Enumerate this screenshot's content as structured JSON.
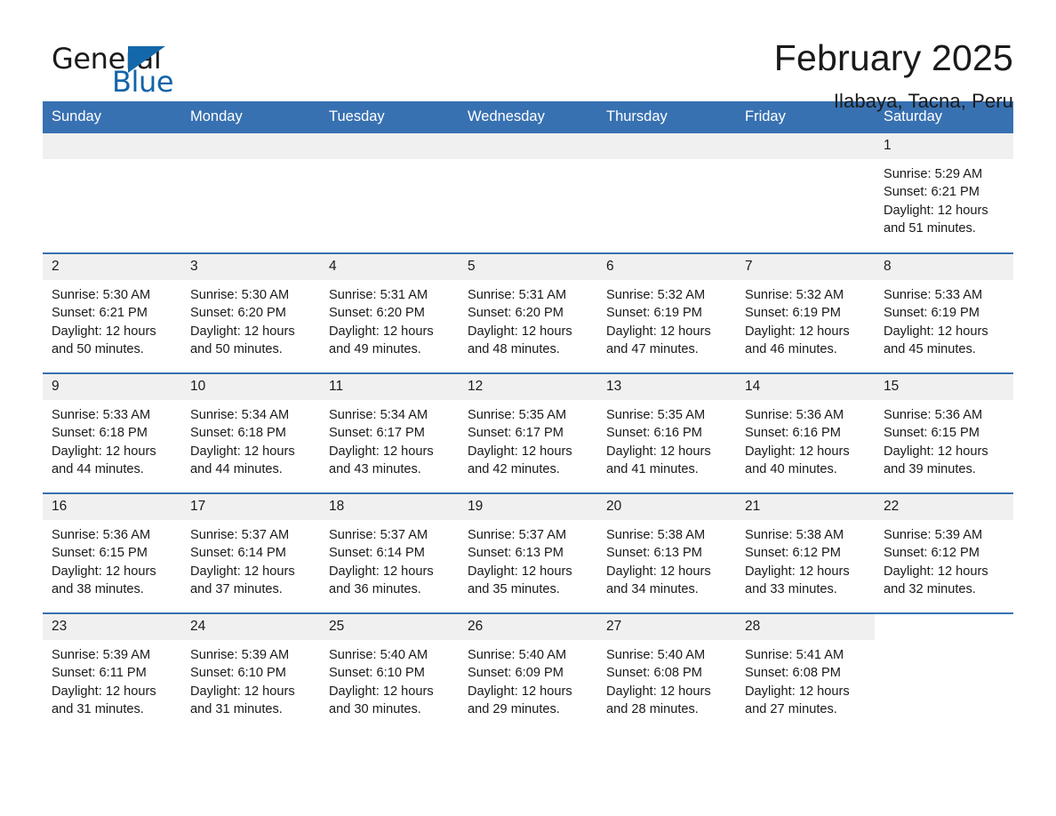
{
  "brand": {
    "word1": "General",
    "word2": "Blue",
    "flag_icon": "triangle-flag-icon",
    "accent_color": "#1368ab"
  },
  "header": {
    "title": "February 2025",
    "location": "Ilabaya, Tacna, Peru"
  },
  "calendar": {
    "header_bg": "#3871b1",
    "daynum_bg": "#f0f0f0",
    "weekdays": [
      "Sunday",
      "Monday",
      "Tuesday",
      "Wednesday",
      "Thursday",
      "Friday",
      "Saturday"
    ],
    "weeks": [
      [
        {
          "day": "",
          "empty": true,
          "lines": []
        },
        {
          "day": "",
          "empty": true,
          "lines": []
        },
        {
          "day": "",
          "empty": true,
          "lines": []
        },
        {
          "day": "",
          "empty": true,
          "lines": []
        },
        {
          "day": "",
          "empty": true,
          "lines": []
        },
        {
          "day": "",
          "empty": true,
          "lines": []
        },
        {
          "day": "1",
          "empty": false,
          "lines": [
            "Sunrise: 5:29 AM",
            "Sunset: 6:21 PM",
            "Daylight: 12 hours",
            "and 51 minutes."
          ]
        }
      ],
      [
        {
          "day": "2",
          "empty": false,
          "lines": [
            "Sunrise: 5:30 AM",
            "Sunset: 6:21 PM",
            "Daylight: 12 hours",
            "and 50 minutes."
          ]
        },
        {
          "day": "3",
          "empty": false,
          "lines": [
            "Sunrise: 5:30 AM",
            "Sunset: 6:20 PM",
            "Daylight: 12 hours",
            "and 50 minutes."
          ]
        },
        {
          "day": "4",
          "empty": false,
          "lines": [
            "Sunrise: 5:31 AM",
            "Sunset: 6:20 PM",
            "Daylight: 12 hours",
            "and 49 minutes."
          ]
        },
        {
          "day": "5",
          "empty": false,
          "lines": [
            "Sunrise: 5:31 AM",
            "Sunset: 6:20 PM",
            "Daylight: 12 hours",
            "and 48 minutes."
          ]
        },
        {
          "day": "6",
          "empty": false,
          "lines": [
            "Sunrise: 5:32 AM",
            "Sunset: 6:19 PM",
            "Daylight: 12 hours",
            "and 47 minutes."
          ]
        },
        {
          "day": "7",
          "empty": false,
          "lines": [
            "Sunrise: 5:32 AM",
            "Sunset: 6:19 PM",
            "Daylight: 12 hours",
            "and 46 minutes."
          ]
        },
        {
          "day": "8",
          "empty": false,
          "lines": [
            "Sunrise: 5:33 AM",
            "Sunset: 6:19 PM",
            "Daylight: 12 hours",
            "and 45 minutes."
          ]
        }
      ],
      [
        {
          "day": "9",
          "empty": false,
          "lines": [
            "Sunrise: 5:33 AM",
            "Sunset: 6:18 PM",
            "Daylight: 12 hours",
            "and 44 minutes."
          ]
        },
        {
          "day": "10",
          "empty": false,
          "lines": [
            "Sunrise: 5:34 AM",
            "Sunset: 6:18 PM",
            "Daylight: 12 hours",
            "and 44 minutes."
          ]
        },
        {
          "day": "11",
          "empty": false,
          "lines": [
            "Sunrise: 5:34 AM",
            "Sunset: 6:17 PM",
            "Daylight: 12 hours",
            "and 43 minutes."
          ]
        },
        {
          "day": "12",
          "empty": false,
          "lines": [
            "Sunrise: 5:35 AM",
            "Sunset: 6:17 PM",
            "Daylight: 12 hours",
            "and 42 minutes."
          ]
        },
        {
          "day": "13",
          "empty": false,
          "lines": [
            "Sunrise: 5:35 AM",
            "Sunset: 6:16 PM",
            "Daylight: 12 hours",
            "and 41 minutes."
          ]
        },
        {
          "day": "14",
          "empty": false,
          "lines": [
            "Sunrise: 5:36 AM",
            "Sunset: 6:16 PM",
            "Daylight: 12 hours",
            "and 40 minutes."
          ]
        },
        {
          "day": "15",
          "empty": false,
          "lines": [
            "Sunrise: 5:36 AM",
            "Sunset: 6:15 PM",
            "Daylight: 12 hours",
            "and 39 minutes."
          ]
        }
      ],
      [
        {
          "day": "16",
          "empty": false,
          "lines": [
            "Sunrise: 5:36 AM",
            "Sunset: 6:15 PM",
            "Daylight: 12 hours",
            "and 38 minutes."
          ]
        },
        {
          "day": "17",
          "empty": false,
          "lines": [
            "Sunrise: 5:37 AM",
            "Sunset: 6:14 PM",
            "Daylight: 12 hours",
            "and 37 minutes."
          ]
        },
        {
          "day": "18",
          "empty": false,
          "lines": [
            "Sunrise: 5:37 AM",
            "Sunset: 6:14 PM",
            "Daylight: 12 hours",
            "and 36 minutes."
          ]
        },
        {
          "day": "19",
          "empty": false,
          "lines": [
            "Sunrise: 5:37 AM",
            "Sunset: 6:13 PM",
            "Daylight: 12 hours",
            "and 35 minutes."
          ]
        },
        {
          "day": "20",
          "empty": false,
          "lines": [
            "Sunrise: 5:38 AM",
            "Sunset: 6:13 PM",
            "Daylight: 12 hours",
            "and 34 minutes."
          ]
        },
        {
          "day": "21",
          "empty": false,
          "lines": [
            "Sunrise: 5:38 AM",
            "Sunset: 6:12 PM",
            "Daylight: 12 hours",
            "and 33 minutes."
          ]
        },
        {
          "day": "22",
          "empty": false,
          "lines": [
            "Sunrise: 5:39 AM",
            "Sunset: 6:12 PM",
            "Daylight: 12 hours",
            "and 32 minutes."
          ]
        }
      ],
      [
        {
          "day": "23",
          "empty": false,
          "lines": [
            "Sunrise: 5:39 AM",
            "Sunset: 6:11 PM",
            "Daylight: 12 hours",
            "and 31 minutes."
          ]
        },
        {
          "day": "24",
          "empty": false,
          "lines": [
            "Sunrise: 5:39 AM",
            "Sunset: 6:10 PM",
            "Daylight: 12 hours",
            "and 31 minutes."
          ]
        },
        {
          "day": "25",
          "empty": false,
          "lines": [
            "Sunrise: 5:40 AM",
            "Sunset: 6:10 PM",
            "Daylight: 12 hours",
            "and 30 minutes."
          ]
        },
        {
          "day": "26",
          "empty": false,
          "lines": [
            "Sunrise: 5:40 AM",
            "Sunset: 6:09 PM",
            "Daylight: 12 hours",
            "and 29 minutes."
          ]
        },
        {
          "day": "27",
          "empty": false,
          "lines": [
            "Sunrise: 5:40 AM",
            "Sunset: 6:08 PM",
            "Daylight: 12 hours",
            "and 28 minutes."
          ]
        },
        {
          "day": "28",
          "empty": false,
          "lines": [
            "Sunrise: 5:41 AM",
            "Sunset: 6:08 PM",
            "Daylight: 12 hours",
            "and 27 minutes."
          ]
        },
        {
          "day": "",
          "empty": true,
          "blank": true,
          "lines": []
        }
      ]
    ]
  }
}
